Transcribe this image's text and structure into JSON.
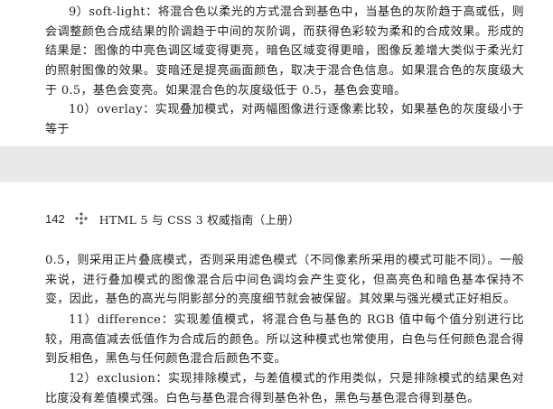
{
  "top_page": {
    "paragraphs": [
      "9）soft-light：将混合色以柔光的方式混合到基色中，当基色的灰阶趋于高或低，则会调整颜色合成结果的阶调趋于中间的灰阶调，而获得色彩较为柔和的合成效果。形成的结果是：图像的中亮色调区域变得更亮，暗色区域变得更暗，图像反差增大类似于柔光灯的照射图像的效果。变暗还是提亮画面颜色，取决于混合色信息。如果混合色的灰度级大于 0.5，基色会变亮。如果混合色的灰度级低于 0.5，基色会变暗。",
      "10）overlay：实现叠加模式，对两幅图像进行逐像素比较，如果基色的灰度级小于等于"
    ]
  },
  "bottom_page": {
    "header": {
      "page_number": "142",
      "icon": "diamond-ornament-icon",
      "book_title": "HTML 5 与 CSS 3 权威指南（上册）"
    },
    "paragraphs": [
      "0.5，则采用正片叠底模式，否则采用滤色模式（不同像素所采用的模式可能不同）。一般来说，进行叠加模式的图像混合后中间色调均会产生变化，但高亮色和暗色基本保持不变，因此，基色的高光与阴影部分的亮度细节就会被保留。其效果与强光模式正好相反。",
      "11）difference：实现差值模式，将混合色与基色的 RGB 值中每个值分别进行比较，用高值减去低值作为合成后的颜色。所以这种模式也常使用，白色与任何颜色混合得到反相色，黑色与任何颜色混合后颜色不变。",
      "12）exclusion：实现排除模式，与差值模式的作用类似，只是排除模式的结果色对比度没有差值模式强。白色与基色混合得到基色补色，黑色与基色混合得到基色。"
    ]
  },
  "colors": {
    "text": "#222222",
    "page_gap": "#e9e9e9",
    "background": "#ffffff"
  }
}
